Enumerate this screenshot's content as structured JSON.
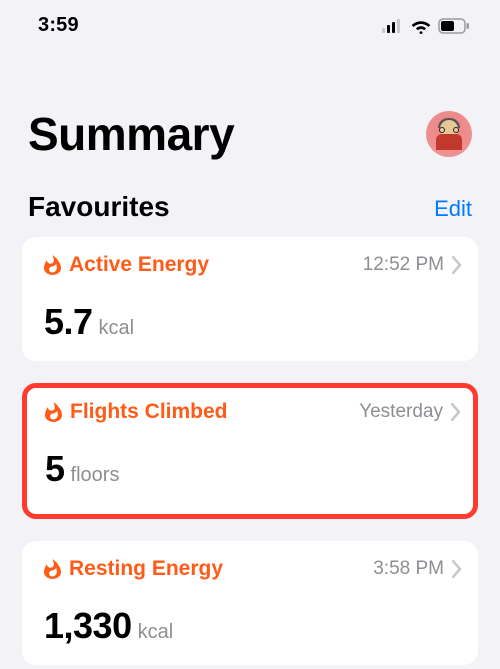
{
  "statusbar": {
    "time": "3:59"
  },
  "header": {
    "title": "Summary"
  },
  "favourites": {
    "heading": "Favourites",
    "edit_label": "Edit",
    "items": [
      {
        "title": "Active Energy",
        "time": "12:52 PM",
        "value": "5.7",
        "unit": "kcal"
      },
      {
        "title": "Flights Climbed",
        "time": "Yesterday",
        "value": "5",
        "unit": "floors"
      },
      {
        "title": "Resting Energy",
        "time": "3:58 PM",
        "value": "1,330",
        "unit": "kcal"
      }
    ]
  }
}
